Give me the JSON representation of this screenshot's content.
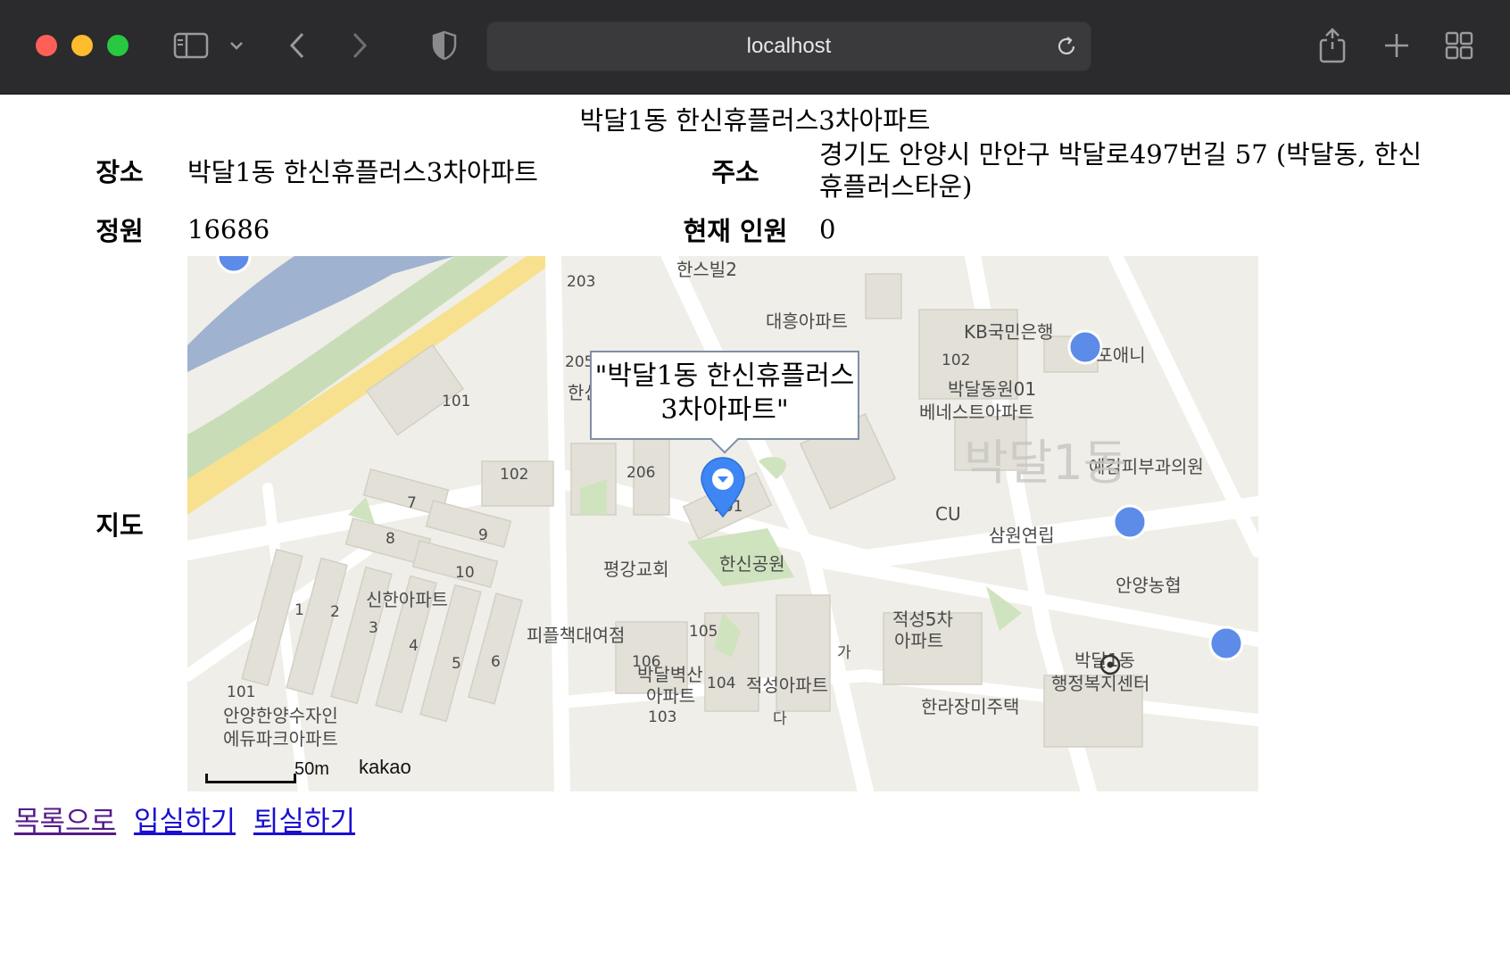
{
  "browser": {
    "url": "localhost",
    "colors": {
      "close": "#fe5f57",
      "minimize": "#febc2e",
      "maximize": "#28c840"
    },
    "icons": [
      "sidebar-icon",
      "chevron-down-icon",
      "back-icon",
      "forward-icon",
      "shield-icon",
      "reload-icon",
      "share-icon",
      "plus-icon",
      "tab-overview-icon"
    ]
  },
  "page": {
    "title": "박달1동 한신휴플러스3차아파트",
    "rows": {
      "place_label": "장소",
      "place_value": "박달1동 한신휴플러스3차아파트",
      "address_label": "주소",
      "address_value": "경기도 안양시 만안구 박달로497번길 57 (박달동, 한신휴플러스타운)",
      "capacity_label": "정원",
      "capacity_value": "16686",
      "current_label": "현재 인원",
      "current_value": "0",
      "map_label": "지도"
    },
    "map": {
      "infowindow": "\"박달1동 한신휴플러스3차아파트\"",
      "scale": "50m",
      "provider": "kakao",
      "district_label": "박달1동",
      "labels": [
        "한스빌2",
        "203",
        "대흥아파트",
        "KB국민은행",
        "스포애니",
        "205",
        "한신",
        "101",
        "102",
        "박달동원01",
        "베네스트아파트",
        "206",
        "102",
        "201",
        "예김피부과의원",
        "7",
        "9",
        "8",
        "10",
        "CU",
        "삼원연립",
        "평강교회",
        "한신공원",
        "1",
        "2",
        "3",
        "4",
        "5",
        "6",
        "신한아파트",
        "안양농협",
        "피플책대여점",
        "105",
        "적성5차",
        "아파트",
        "106",
        "박달벽산",
        "아파트",
        "104",
        "적성아파트",
        "가",
        "박달1동",
        "행정복지센터",
        "101",
        "안양한양수자인",
        "에듀파크아파트",
        "103",
        "다",
        "한라장미주택"
      ]
    },
    "links": {
      "list": "목록으로",
      "enter": "입실하기",
      "exit": "퇴실하기"
    }
  }
}
